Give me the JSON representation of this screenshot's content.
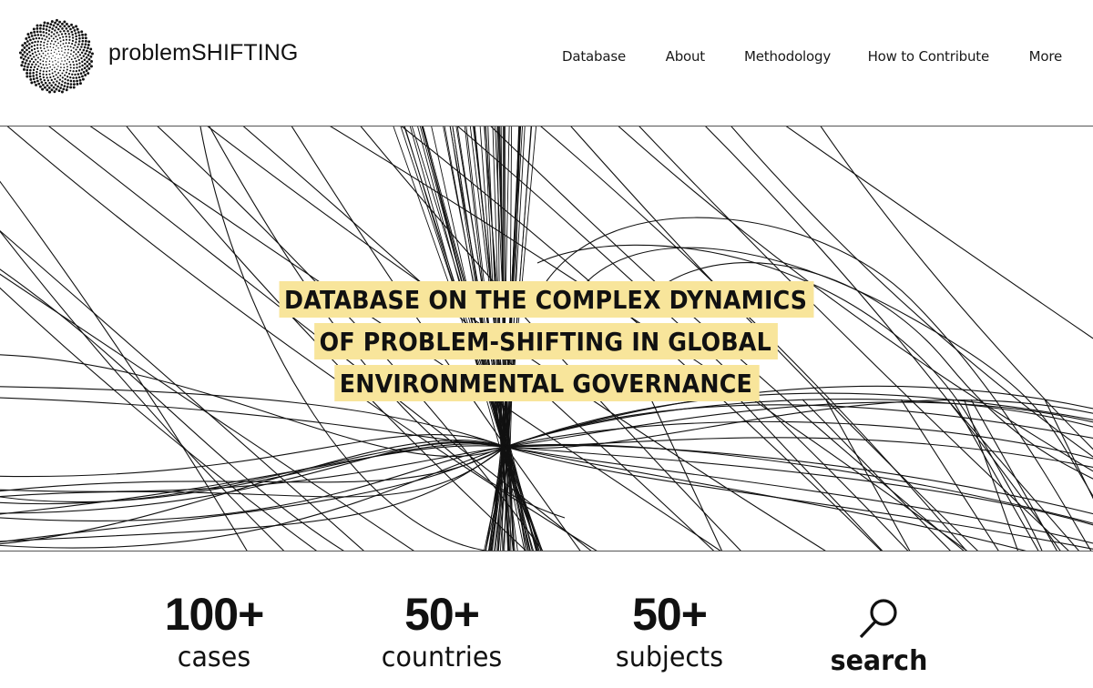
{
  "header": {
    "brand": "problemSHIFTING",
    "logo_icon": "sunflower-dot-spiral-icon",
    "nav": [
      {
        "label": "Database"
      },
      {
        "label": "About"
      },
      {
        "label": "Methodology"
      },
      {
        "label": "How to Contribute"
      },
      {
        "label": "More"
      }
    ]
  },
  "hero": {
    "headline_lines": [
      "DATABASE ON THE COMPLEX DYNAMICS",
      "OF PROBLEM-SHIFTING IN GLOBAL",
      "ENVIRONMENTAL GOVERNANCE"
    ],
    "highlight_color": "#f8e59b",
    "background_art": "black-line-bundle-illustration"
  },
  "stats": [
    {
      "value": "100+",
      "label": "cases"
    },
    {
      "value": "50+",
      "label": "countries"
    },
    {
      "value": "50+",
      "label": "subjects"
    }
  ],
  "search": {
    "label": "search",
    "icon": "search-icon"
  }
}
